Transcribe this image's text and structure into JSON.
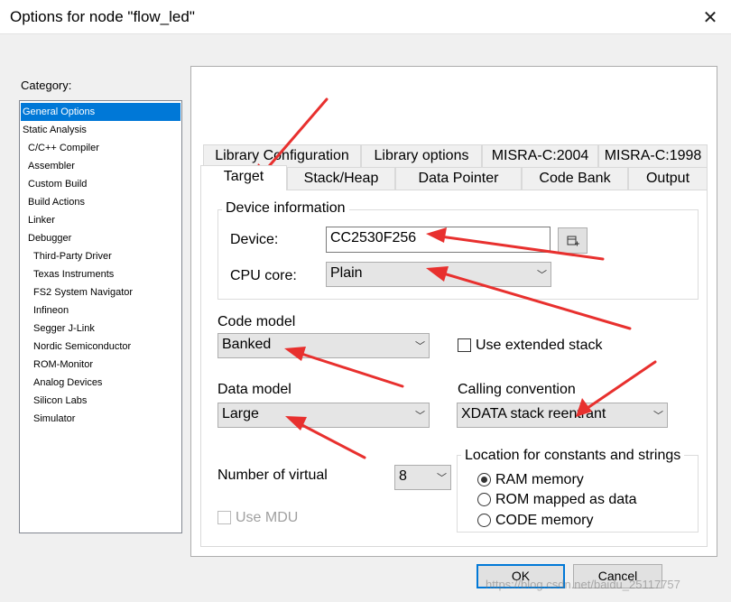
{
  "window": {
    "title": "Options for node \"flow_led\"",
    "close_glyph": "✕"
  },
  "category": {
    "label": "Category:",
    "items": [
      "General Options",
      "Static Analysis",
      "C/C++ Compiler",
      "Assembler",
      "Custom Build",
      "Build Actions",
      "Linker",
      "Debugger",
      "Third-Party Driver",
      "Texas Instruments",
      "FS2 System Navigator",
      "Infineon",
      "Segger J-Link",
      "Nordic Semiconductor",
      "ROM-Monitor",
      "Analog Devices",
      "Silicon Labs",
      "Simulator"
    ],
    "selected_index": 0
  },
  "tabs": {
    "row1": [
      "Library Configuration",
      "Library options",
      "MISRA-C:2004",
      "MISRA-C:1998"
    ],
    "row2": [
      "Target",
      "Stack/Heap",
      "Data Pointer",
      "Code Bank",
      "Output"
    ],
    "active": "Target"
  },
  "device_info": {
    "title": "Device information",
    "device_label": "Device:",
    "device_value": "CC2530F256",
    "browse_icon": "browse-icon",
    "cpu_label": "CPU core:",
    "cpu_value": "Plain"
  },
  "code_model": {
    "label": "Code model",
    "value": "Banked"
  },
  "extended_stack": {
    "label": "Use extended stack",
    "checked": false
  },
  "data_model": {
    "label": "Data model",
    "value": "Large"
  },
  "calling_convention": {
    "label": "Calling convention",
    "value": "XDATA stack reentrant"
  },
  "virtual": {
    "label": "Number of virtual",
    "value": "8"
  },
  "location": {
    "title": "Location for constants and strings",
    "options": [
      "RAM memory",
      "ROM mapped as data",
      "CODE memory"
    ],
    "selected": "RAM memory"
  },
  "mdu": {
    "label": "Use MDU",
    "checked": false,
    "enabled": false
  },
  "buttons": {
    "ok": "OK",
    "cancel": "Cancel"
  },
  "watermark": "https://blog.csdn.net/baidu_25117757",
  "colors": {
    "selection": "#0078d7",
    "annotation_arrow": "#e8302e"
  }
}
